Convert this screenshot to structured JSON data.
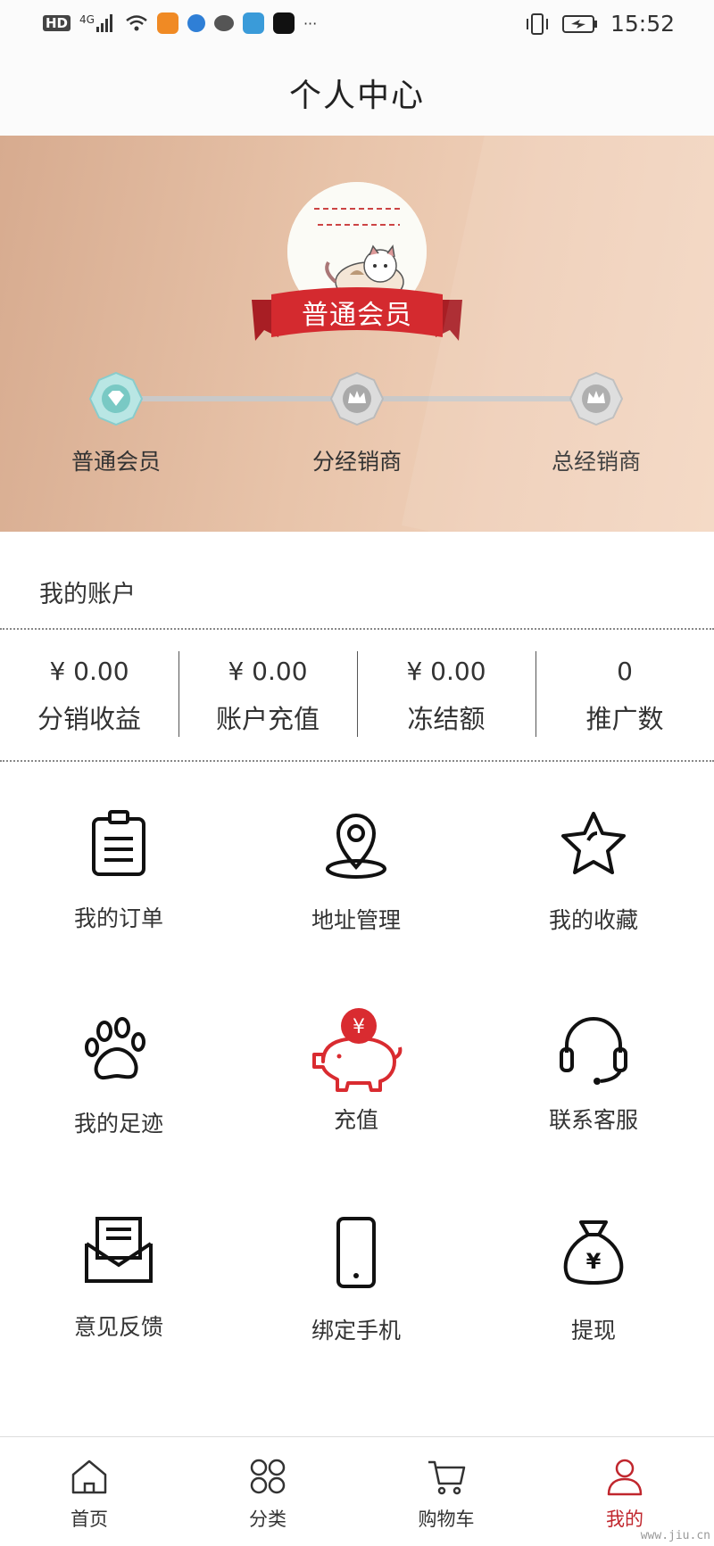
{
  "status_bar": {
    "left_badges": [
      "HD",
      "4G"
    ],
    "time": "15:52"
  },
  "header": {
    "title": "个人中心"
  },
  "profile": {
    "level_ribbon": "普通会员",
    "levels": [
      "普通会员",
      "分经销商",
      "总经销商"
    ]
  },
  "account": {
    "title": "我的账户",
    "stats": [
      {
        "value": "¥ 0.00",
        "label": "分销收益"
      },
      {
        "value": "¥ 0.00",
        "label": "账户充值"
      },
      {
        "value": "¥ 0.00",
        "label": "冻结额"
      },
      {
        "value": "0",
        "label": "推广数"
      }
    ]
  },
  "menu": [
    {
      "label": "我的订单",
      "icon": "clipboard-icon"
    },
    {
      "label": "地址管理",
      "icon": "location-pin-icon"
    },
    {
      "label": "我的收藏",
      "icon": "star-icon"
    },
    {
      "label": "我的足迹",
      "icon": "paw-icon"
    },
    {
      "label": "充值",
      "icon": "piggy-bank-icon"
    },
    {
      "label": "联系客服",
      "icon": "headset-icon"
    },
    {
      "label": "意见反馈",
      "icon": "envelope-icon"
    },
    {
      "label": "绑定手机",
      "icon": "phone-icon"
    },
    {
      "label": "提现",
      "icon": "money-bag-icon"
    }
  ],
  "tabs": [
    {
      "label": "首页",
      "icon": "home-icon"
    },
    {
      "label": "分类",
      "icon": "category-icon"
    },
    {
      "label": "购物车",
      "icon": "cart-icon"
    },
    {
      "label": "我的",
      "icon": "user-icon",
      "active": true
    }
  ],
  "watermark": "www.jiu.cn",
  "colors": {
    "accent": "#c0262d",
    "ribbon": "#d42a2f"
  }
}
